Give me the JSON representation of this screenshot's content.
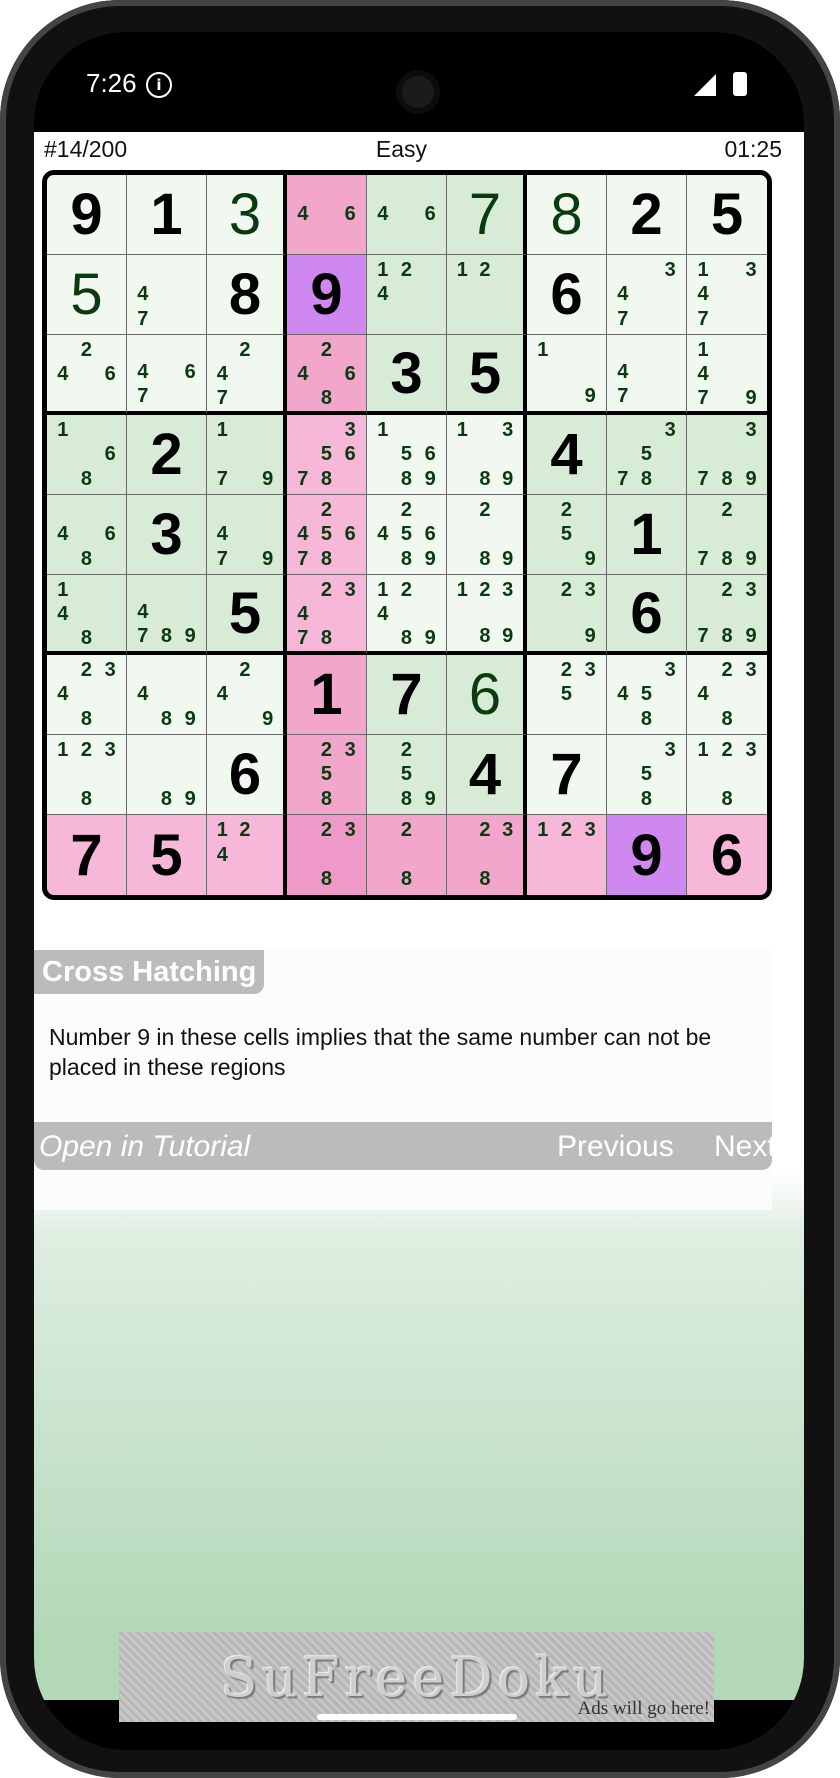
{
  "status_bar": {
    "time": "7:26"
  },
  "header": {
    "puzzle_id": "#14/200",
    "difficulty": "Easy",
    "timer": "01:25"
  },
  "board": {
    "colors": {
      "G": "#f0f8ef",
      "D": "#d7ebd6",
      "P": "#f2a6cc",
      "Q": "#f7b7d9",
      "R": "#ee99c8",
      "V": "#cf88ef"
    },
    "shading": [
      "GGGPDDGGG",
      "GGGVDDGGG",
      "GGGPDDGGG",
      "DDDQGGDDD",
      "DDDQGGDDD",
      "DDDQGGDDD",
      "GGGPDDGGG",
      "GGGPDDGGG",
      "QQQRPPQVQ"
    ],
    "cells": [
      [
        {
          "g": "9"
        },
        {
          "g": "1"
        },
        {
          "s": "3"
        },
        {
          "c": [
            4,
            6
          ]
        },
        {
          "c": [
            4,
            6
          ]
        },
        {
          "s": "7"
        },
        {
          "s": "8"
        },
        {
          "g": "2"
        },
        {
          "g": "5"
        }
      ],
      [
        {
          "s": "5"
        },
        {
          "c": [
            4,
            7
          ]
        },
        {
          "g": "8"
        },
        {
          "g": "9"
        },
        {
          "c": [
            1,
            2,
            4
          ]
        },
        {
          "c": [
            1,
            2
          ]
        },
        {
          "g": "6"
        },
        {
          "c": [
            3,
            4,
            7
          ]
        },
        {
          "c": [
            1,
            3,
            4,
            7
          ]
        }
      ],
      [
        {
          "c": [
            2,
            4,
            6
          ]
        },
        {
          "c": [
            4,
            6,
            7
          ]
        },
        {
          "c": [
            2,
            4,
            7
          ]
        },
        {
          "c": [
            2,
            4,
            6,
            8
          ]
        },
        {
          "g": "3"
        },
        {
          "g": "5"
        },
        {
          "c": [
            1,
            9
          ]
        },
        {
          "c": [
            4,
            7
          ]
        },
        {
          "c": [
            1,
            4,
            7,
            9
          ]
        }
      ],
      [
        {
          "c": [
            1,
            6,
            8
          ]
        },
        {
          "g": "2"
        },
        {
          "c": [
            1,
            7,
            9
          ]
        },
        {
          "c": [
            3,
            5,
            6,
            7,
            8
          ]
        },
        {
          "c": [
            1,
            5,
            6,
            8,
            9
          ]
        },
        {
          "c": [
            1,
            3,
            8,
            9
          ]
        },
        {
          "g": "4"
        },
        {
          "c": [
            3,
            5,
            7,
            8
          ]
        },
        {
          "c": [
            3,
            7,
            8,
            9
          ]
        }
      ],
      [
        {
          "c": [
            4,
            6,
            8
          ]
        },
        {
          "g": "3"
        },
        {
          "c": [
            4,
            7,
            9
          ]
        },
        {
          "c": [
            2,
            4,
            5,
            6,
            7,
            8
          ]
        },
        {
          "c": [
            2,
            4,
            5,
            6,
            8,
            9
          ]
        },
        {
          "c": [
            2,
            8,
            9
          ]
        },
        {
          "c": [
            2,
            5,
            9
          ]
        },
        {
          "g": "1"
        },
        {
          "c": [
            2,
            7,
            8,
            9
          ]
        }
      ],
      [
        {
          "c": [
            1,
            4,
            8
          ]
        },
        {
          "c": [
            4,
            7,
            8,
            9
          ]
        },
        {
          "g": "5"
        },
        {
          "c": [
            2,
            3,
            4,
            7,
            8
          ]
        },
        {
          "c": [
            1,
            2,
            4,
            8,
            9
          ]
        },
        {
          "c": [
            1,
            2,
            3,
            8,
            9
          ]
        },
        {
          "c": [
            2,
            3,
            9
          ]
        },
        {
          "g": "6"
        },
        {
          "c": [
            2,
            3,
            7,
            8,
            9
          ]
        }
      ],
      [
        {
          "c": [
            2,
            3,
            4,
            8
          ]
        },
        {
          "c": [
            4,
            8,
            9
          ]
        },
        {
          "c": [
            2,
            4,
            9
          ]
        },
        {
          "g": "1"
        },
        {
          "g": "7"
        },
        {
          "s": "6"
        },
        {
          "c": [
            2,
            3,
            5
          ]
        },
        {
          "c": [
            3,
            4,
            5,
            8
          ]
        },
        {
          "c": [
            2,
            3,
            4,
            8
          ]
        }
      ],
      [
        {
          "c": [
            1,
            2,
            3,
            8
          ]
        },
        {
          "c": [
            8,
            9
          ]
        },
        {
          "g": "6"
        },
        {
          "c": [
            2,
            3,
            5,
            8
          ]
        },
        {
          "c": [
            2,
            5,
            8,
            9
          ]
        },
        {
          "g": "4"
        },
        {
          "g": "7"
        },
        {
          "c": [
            3,
            5,
            8
          ]
        },
        {
          "c": [
            1,
            2,
            3,
            8
          ]
        }
      ],
      [
        {
          "g": "7"
        },
        {
          "g": "5"
        },
        {
          "c": [
            1,
            2,
            4
          ]
        },
        {
          "c": [
            2,
            3,
            8
          ]
        },
        {
          "c": [
            2,
            8
          ]
        },
        {
          "c": [
            2,
            3,
            8
          ]
        },
        {
          "c": [
            1,
            2,
            3
          ]
        },
        {
          "g": "9"
        },
        {
          "g": "6"
        }
      ]
    ]
  },
  "hint": {
    "title": "Cross Hatching",
    "text": "Number 9 in these cells implies that the same number can not be placed in these regions",
    "open_tutorial": "Open in Tutorial",
    "previous": "Previous",
    "next": "Next"
  },
  "ad": {
    "logo": "SuFreeDoku",
    "subtitle": "Ads will go here!"
  }
}
